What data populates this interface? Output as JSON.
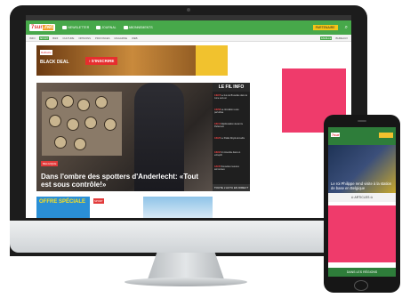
{
  "desktop": {
    "topstrip": {
      "left": "",
      "right": ""
    },
    "header": {
      "logo_main": "7sur",
      "logo_accent": ".net",
      "items": [
        "NEWSLETTER",
        "JOURNAL",
        "ABONNEMENTS"
      ],
      "promo": "PARTENAIRE",
      "search_icon": "search-icon"
    },
    "nav": {
      "items": [
        "INFO",
        "SPORT",
        "BIZZ",
        "CULTURE",
        "OPINIONS",
        "PROVINCES",
        "MAGAZINE",
        "WEB"
      ],
      "active_index": 1,
      "right": [
        "FAMILLE",
        "BUREAUX"
      ]
    },
    "ad": {
      "brand": "Delhaize",
      "text": "BLACK DEAL",
      "cta": "› S'INSCRIRE"
    },
    "hero": {
      "badge": "BELGIQUE",
      "title": "Dans l'ombre des spotters d'Anderlecht: «Tout est sous contrôle!»"
    },
    "fil_info": {
      "title": "LE FIL INFO",
      "items": [
        {
          "time": "14h07",
          "text": "Le bus de Bruxelles dans la zone sud est"
        },
        {
          "time": "13h58",
          "text": "La circulation a été perturbée"
        },
        {
          "time": "13h41",
          "text": "Manifestation devant le Parlement"
        },
        {
          "time": "13h20",
          "text": "Le Palais Royal accueille"
        },
        {
          "time": "13h02",
          "text": "Un incendie dans un entrepôt"
        },
        {
          "time": "12h45",
          "text": "Nouvelles mesures annoncées"
        }
      ],
      "all_link": "TOUTE L'ACTU EN DIRECT"
    },
    "row2": {
      "offre": "OFFRE SPÉCIALE",
      "badge": "SPORT"
    },
    "colors": {
      "green": "#47a84a",
      "red": "#e23a3a",
      "pink": "#ef3b6b"
    }
  },
  "phone": {
    "logo": "7sur",
    "hero_text": "Le roi Philippe rend visite à la station de base en Belgique",
    "articles": "⊙ ARTICLES ⊙",
    "bottom": "DANS LES RÉGIONS"
  }
}
